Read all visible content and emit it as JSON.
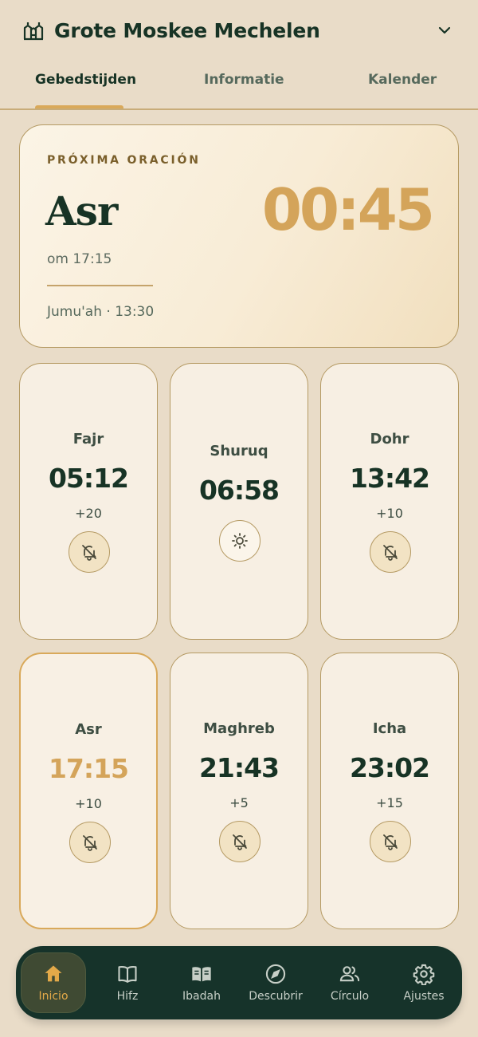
{
  "header": {
    "title": "Grote Moskee Mechelen",
    "icon": "mosque-icon"
  },
  "tabs": [
    {
      "label": "Gebedstijden",
      "active": true
    },
    {
      "label": "Informatie",
      "active": false
    },
    {
      "label": "Kalender",
      "active": false
    }
  ],
  "next_prayer": {
    "label": "PRÓXIMA ORACIÓN",
    "name": "Asr",
    "at": "om 17:15",
    "jumuah": "Jumu'ah · 13:30",
    "countdown": "00:45"
  },
  "prayers": [
    {
      "name": "Fajr",
      "time": "05:12",
      "offset": "+20",
      "icon": "bell-off-icon"
    },
    {
      "name": "Shuruq",
      "time": "06:58",
      "offset": "",
      "icon": "sun-icon"
    },
    {
      "name": "Dohr",
      "time": "13:42",
      "offset": "+10",
      "icon": "bell-off-icon"
    },
    {
      "name": "Asr",
      "time": "17:15",
      "offset": "+10",
      "icon": "bell-off-icon"
    },
    {
      "name": "Maghreb",
      "time": "21:43",
      "offset": "+5",
      "icon": "bell-off-icon"
    },
    {
      "name": "Icha",
      "time": "23:02",
      "offset": "+15",
      "icon": "bell-off-icon"
    }
  ],
  "nav": [
    {
      "label": "Inicio",
      "icon": "home-icon",
      "active": true
    },
    {
      "label": "Hifz",
      "icon": "quran-icon",
      "active": false
    },
    {
      "label": "Ibadah",
      "icon": "book-icon",
      "active": false
    },
    {
      "label": "Descubrir",
      "icon": "compass-icon",
      "active": false
    },
    {
      "label": "Círculo",
      "icon": "people-icon",
      "active": false
    },
    {
      "label": "Ajustes",
      "icon": "gear-icon",
      "active": false
    }
  ],
  "colors": {
    "accent": "#d4a45a",
    "dark": "#173325",
    "background": "#e9dcc8"
  }
}
